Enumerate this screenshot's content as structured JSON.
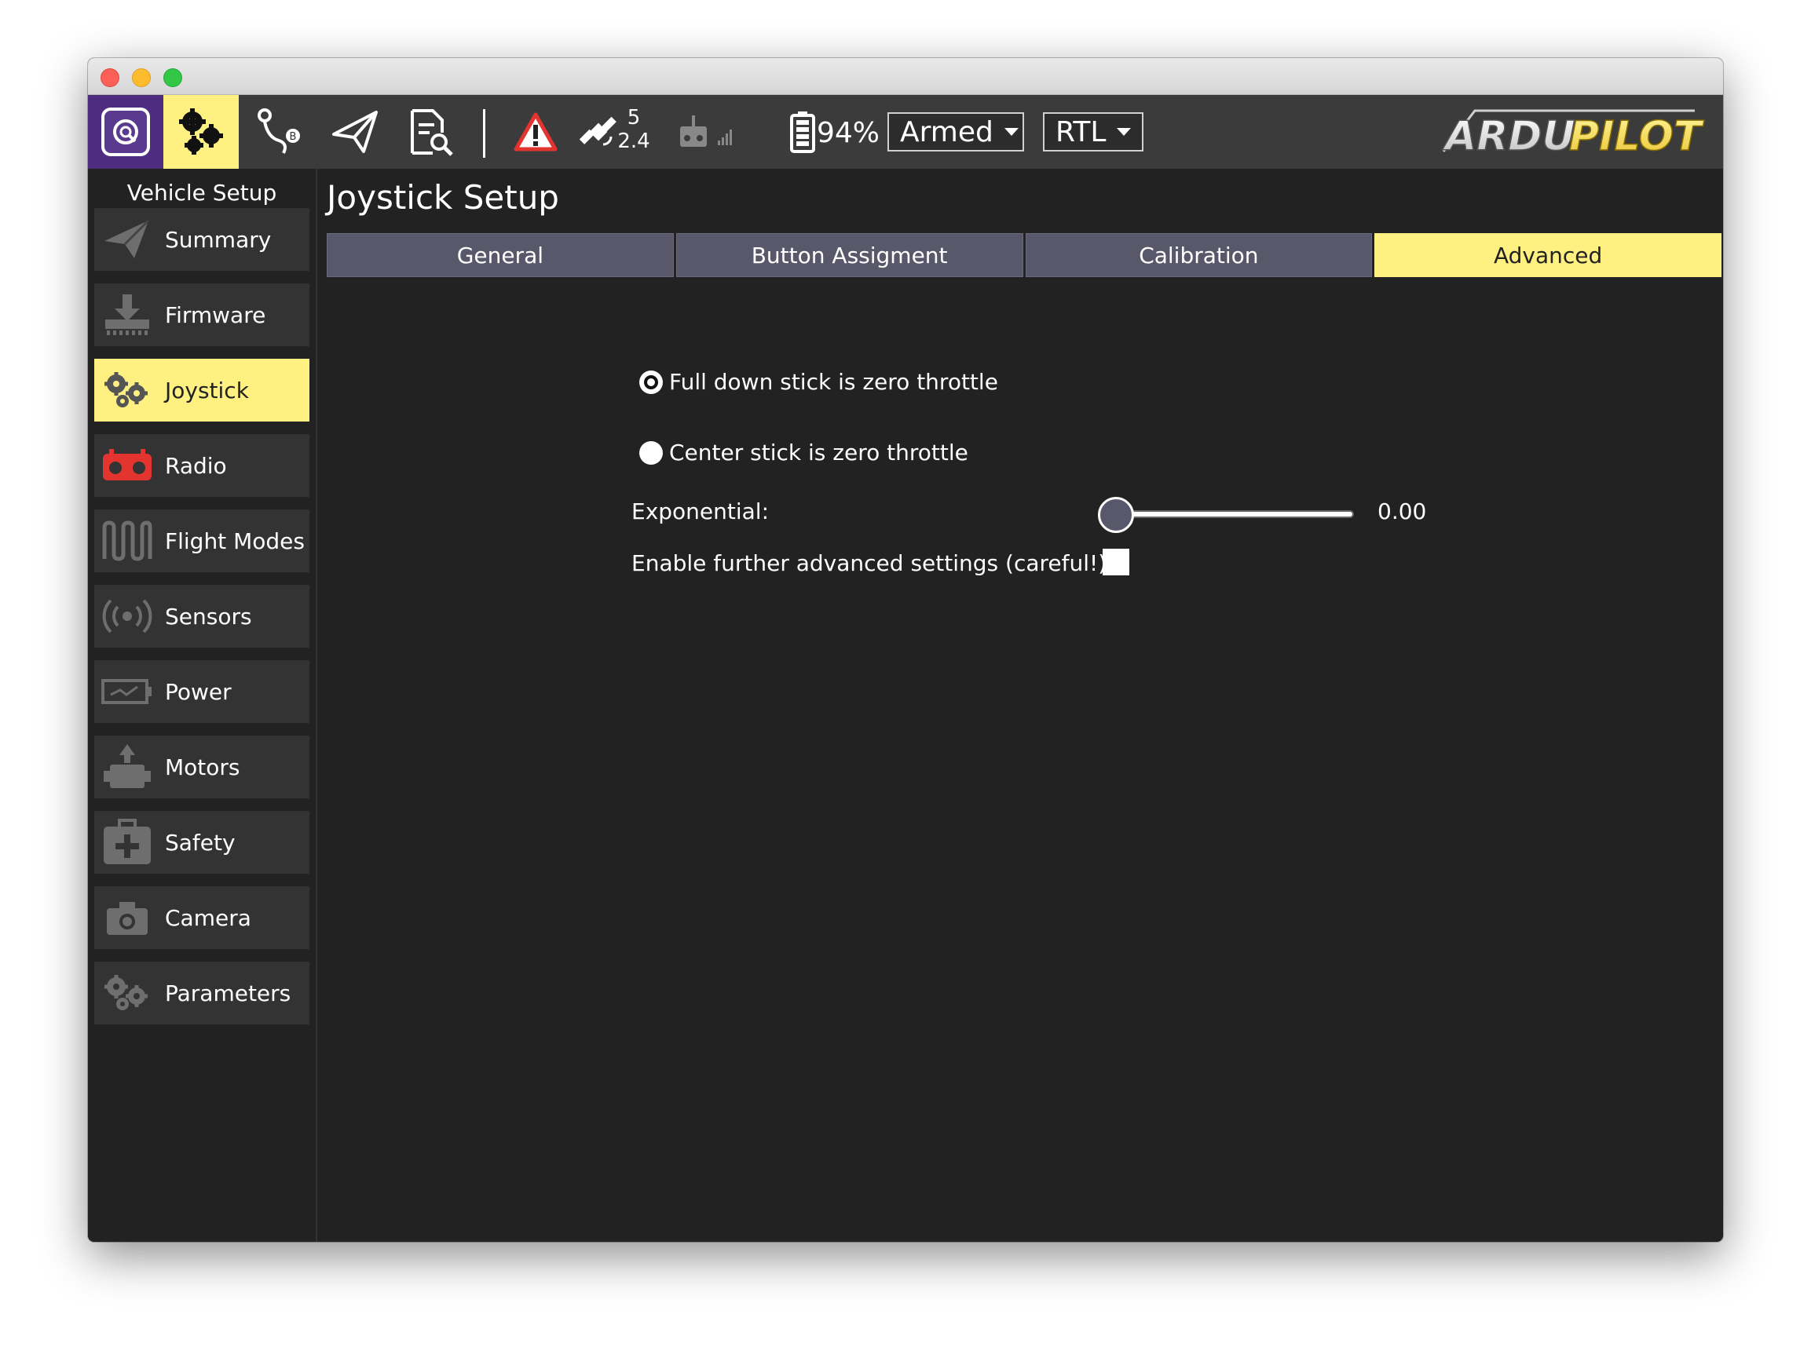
{
  "toolbar": {
    "gps_count": "5",
    "gps_hdop": "2.4",
    "battery": "94%",
    "armed_label": "Armed",
    "flight_mode": "RTL",
    "logo_text": "ARDUPILOT",
    "colors": {
      "active": "#fff082",
      "brand_purple": "#4e2d80",
      "warning": "#e3342f"
    }
  },
  "sidebar": {
    "title": "Vehicle Setup",
    "items": [
      {
        "label": "Summary",
        "icon": "paper-plane-icon"
      },
      {
        "label": "Firmware",
        "icon": "download-icon"
      },
      {
        "label": "Joystick",
        "icon": "gears-icon",
        "active": true
      },
      {
        "label": "Radio",
        "icon": "radio-icon"
      },
      {
        "label": "Flight Modes",
        "icon": "waveform-icon"
      },
      {
        "label": "Sensors",
        "icon": "sensor-icon"
      },
      {
        "label": "Power",
        "icon": "battery-icon"
      },
      {
        "label": "Motors",
        "icon": "motor-icon"
      },
      {
        "label": "Safety",
        "icon": "first-aid-icon"
      },
      {
        "label": "Camera",
        "icon": "camera-icon"
      },
      {
        "label": "Parameters",
        "icon": "gears-icon"
      }
    ]
  },
  "main": {
    "title": "Joystick Setup",
    "tabs": [
      {
        "label": "General"
      },
      {
        "label": "Button Assigment"
      },
      {
        "label": "Calibration"
      },
      {
        "label": "Advanced",
        "active": true
      }
    ],
    "throttle_options": [
      {
        "label": "Full down stick is zero throttle",
        "checked": true
      },
      {
        "label": "Center stick is zero throttle",
        "checked": false
      }
    ],
    "exponential_label": "Exponential:",
    "exponential_value": "0.00",
    "exponential_fraction": 0.0,
    "advanced_label": "Enable further advanced settings (careful!)",
    "advanced_checked": false
  }
}
